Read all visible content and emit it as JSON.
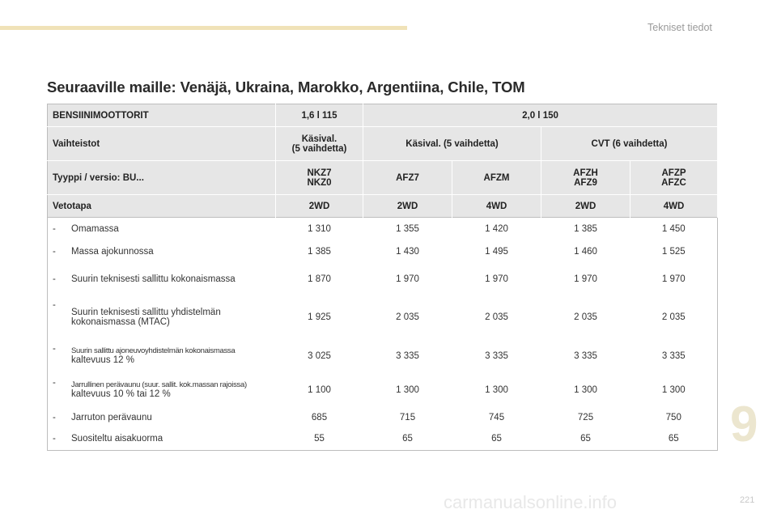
{
  "header": {
    "section_title": "Tekniset tiedot"
  },
  "page_title": "Seuraaville maille: Venäjä, Ukraina, Marokko, Argentiina, Chile, TOM",
  "chapter": "9",
  "page_number": "221",
  "watermark": "carmanualsonline.info",
  "table": {
    "engines_label": "BENSIINIMOOTTORIT",
    "engine_1": "1,6 l 115",
    "engine_2": "2,0 l 150",
    "gearbox_label": "Vaihteistot",
    "gearbox_1_line1": "Käsival.",
    "gearbox_1_line2": "(5 vaihdetta)",
    "gearbox_2": "Käsival. (5 vaihdetta)",
    "gearbox_3": "CVT (6 vaihdetta)",
    "type_label": "Tyyppi / versio: BU...",
    "types": [
      {
        "line1": "NKZ7",
        "line2": "NKZ0"
      },
      {
        "line1": "AFZ7",
        "line2": ""
      },
      {
        "line1": "AFZM",
        "line2": ""
      },
      {
        "line1": "AFZH",
        "line2": "AFZ9"
      },
      {
        "line1": "AFZP",
        "line2": "AFZC"
      }
    ],
    "drive_label": "Vetotapa",
    "drives": [
      "2WD",
      "2WD",
      "4WD",
      "2WD",
      "4WD"
    ],
    "dash": "-",
    "rows": [
      {
        "label": "Omamassa",
        "values": [
          "1 310",
          "1 355",
          "1 420",
          "1 385",
          "1 450"
        ]
      },
      {
        "label": "Massa ajokunnossa",
        "values": [
          "1 385",
          "1 430",
          "1 495",
          "1 460",
          "1 525"
        ]
      },
      {
        "label": "Suurin teknisesti sallittu kokonaismassa",
        "values": [
          "1 870",
          "1 970",
          "1 970",
          "1 970",
          "1 970"
        ]
      },
      {
        "label_line1": "Suurin teknisesti sallittu yhdistelmän",
        "label_line2": "kokonaismassa (MTAC)",
        "values": [
          "1 925",
          "2 035",
          "2 035",
          "2 035",
          "2 035"
        ]
      },
      {
        "label_line1": "Suurin sallittu ajoneuvoyhdistelmän kokonaismassa",
        "label_line2": "kaltevuus 12 %",
        "values": [
          "3 025",
          "3 335",
          "3 335",
          "3 335",
          "3 335"
        ]
      },
      {
        "label_line1": "Jarrullinen perävaunu (suur. sallit. kok.massan rajoissa)",
        "label_line2": "kaltevuus 10 % tai 12 %",
        "values": [
          "1 100",
          "1 300",
          "1 300",
          "1 300",
          "1 300"
        ]
      },
      {
        "label": "Jarruton perävaunu",
        "values": [
          "685",
          "715",
          "745",
          "725",
          "750"
        ]
      },
      {
        "label": "Suositeltu aisakuorma",
        "values": [
          "55",
          "65",
          "65",
          "65",
          "65"
        ]
      }
    ]
  }
}
